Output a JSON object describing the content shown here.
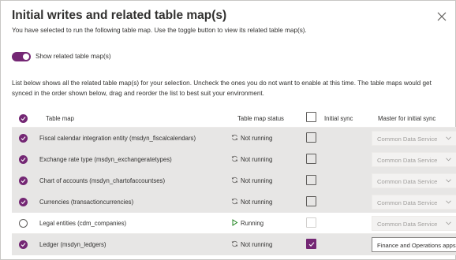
{
  "dialog": {
    "title": "Initial writes and related table map(s)",
    "subtitle": "You have selected to run the following table map. Use the toggle button to view its related table map(s).",
    "toggle_label": "Show related table map(s)",
    "toggle_on": true,
    "description": "List below shows all the related table map(s) for your selection. Uncheck the ones you do not want to enable at this time. The table maps would get synced in the order shown below, drag and reorder the list to best suit your environment."
  },
  "table": {
    "headers": {
      "table_map": "Table map",
      "status": "Table map status",
      "initial_sync": "Initial sync",
      "master": "Master for initial sync"
    },
    "rows": [
      {
        "name": "Fiscal calendar integration entity (msdyn_fiscalcalendars)",
        "status": "Not running",
        "selected": true,
        "initial_sync": false,
        "initial_sync_enabled": true,
        "master": "Common Data Service",
        "master_enabled": false
      },
      {
        "name": "Exchange rate type (msdyn_exchangeratetypes)",
        "status": "Not running",
        "selected": true,
        "initial_sync": false,
        "initial_sync_enabled": true,
        "master": "Common Data Service",
        "master_enabled": false
      },
      {
        "name": "Chart of accounts (msdyn_chartofaccountses)",
        "status": "Not running",
        "selected": true,
        "initial_sync": false,
        "initial_sync_enabled": true,
        "master": "Common Data Service",
        "master_enabled": false
      },
      {
        "name": "Currencies (transactioncurrencies)",
        "status": "Not running",
        "selected": true,
        "initial_sync": false,
        "initial_sync_enabled": true,
        "master": "Common Data Service",
        "master_enabled": false
      },
      {
        "name": "Legal entities (cdm_companies)",
        "status": "Running",
        "selected": false,
        "initial_sync": false,
        "initial_sync_enabled": false,
        "master": "Common Data Service",
        "master_enabled": false
      },
      {
        "name": "Ledger (msdyn_ledgers)",
        "status": "Not running",
        "selected": true,
        "initial_sync": true,
        "initial_sync_enabled": true,
        "master": "Finance and Operations apps",
        "master_enabled": true
      }
    ]
  },
  "colors": {
    "accent": "#742774",
    "selected_row": "#e7e6e5",
    "running_icon": "#107c10"
  },
  "icons": {
    "close": "close-icon",
    "not_running": "sync-icon",
    "running": "play-icon",
    "dropdown": "chevron-down-icon",
    "check": "checkmark-icon"
  }
}
